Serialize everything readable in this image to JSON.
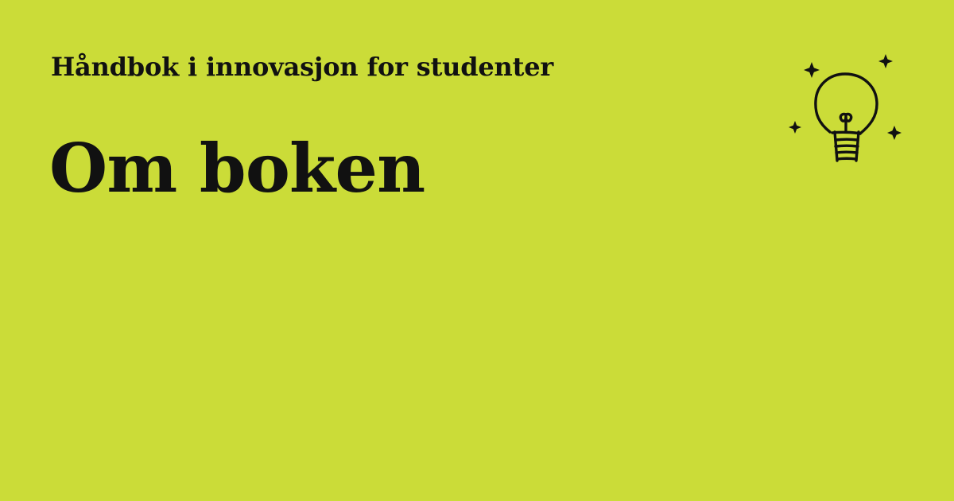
{
  "card": {
    "subtitle": "Håndbok i innovasjon for studenter",
    "title": "Om boken",
    "icon": "lightbulb-icon",
    "background_color": "#cbdc38",
    "text_color": "#111111"
  }
}
